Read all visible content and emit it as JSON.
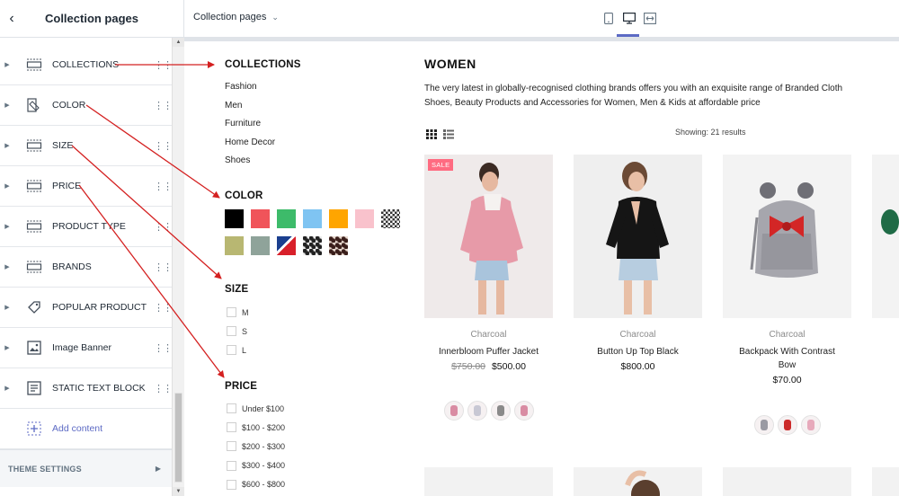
{
  "sidebar": {
    "title": "Collection pages",
    "items": [
      {
        "label": "COLLECTIONS",
        "icon": "section-icon"
      },
      {
        "label": "COLOR",
        "icon": "color-filter-icon"
      },
      {
        "label": "SIZE",
        "icon": "section-icon"
      },
      {
        "label": "PRICE",
        "icon": "section-icon"
      },
      {
        "label": "PRODUCT TYPE",
        "icon": "section-icon"
      },
      {
        "label": "BRANDS",
        "icon": "section-icon"
      },
      {
        "label": "POPULAR PRODUCT",
        "icon": "tag-icon"
      },
      {
        "label": "Image Banner",
        "icon": "image-icon"
      },
      {
        "label": "STATIC TEXT BLOCK",
        "icon": "text-block-icon"
      }
    ],
    "add_content": "Add content",
    "theme_settings": "THEME SETTINGS"
  },
  "topbar": {
    "page_selector": "Collection pages",
    "views": [
      "mobile-view-icon",
      "desktop-view-icon",
      "fullscreen-view-icon"
    ],
    "accent": "#5c6ac4"
  },
  "filters": {
    "collections_title": "COLLECTIONS",
    "collections": [
      "Fashion",
      "Men",
      "Furniture",
      "Home Decor",
      "Shoes"
    ],
    "color_title": "COLOR",
    "colors_row1": [
      "#000000",
      "#f0545a",
      "#3dbb6a",
      "#7fc4f2",
      "#ffa500",
      "#f9c2cc",
      "pattern-checker"
    ],
    "colors_row2": [
      "#b8b772",
      "#8fa39a",
      "pattern-flag",
      "pattern-leopard-white",
      "pattern-leopard-cream"
    ],
    "size_title": "SIZE",
    "sizes": [
      "M",
      "S",
      "L"
    ],
    "price_title": "PRICE",
    "prices": [
      "Under $100",
      "$100 - $200",
      "$200 - $300",
      "$300 - $400",
      "$600 - $800"
    ]
  },
  "collection": {
    "title": "WOMEN",
    "description_line1": "The very latest in globally-recognised clothing brands offers you with an exquisite range of Branded Cloth",
    "description_line2": "Shoes, Beauty Products and Accessories for Women, Men & Kids at affordable price",
    "showing": "Showing: 21 results",
    "view_icons": [
      "grid-view-icon",
      "list-view-icon"
    ],
    "products": [
      {
        "badge": "SALE",
        "vendor": "Charcoal",
        "name": "Innerbloom Puffer Jacket",
        "old_price": "$750.00",
        "price": "$500.00",
        "thumbs": [
          "#d98ca3",
          "#c8c8d4",
          "#8a8a8a",
          "#d98ca3"
        ]
      },
      {
        "badge": "",
        "vendor": "Charcoal",
        "name": "Button Up Top Black",
        "old_price": "",
        "price": "$800.00",
        "thumbs": []
      },
      {
        "badge": "",
        "vendor": "Charcoal",
        "name_line1": "Backpack With Contrast",
        "name_line2": "Bow",
        "old_price": "",
        "price": "$70.00",
        "thumbs": [
          "#9a9aa3",
          "#cc2a2a",
          "#e7a9bb"
        ]
      }
    ]
  },
  "annotation_color": "#d42020"
}
